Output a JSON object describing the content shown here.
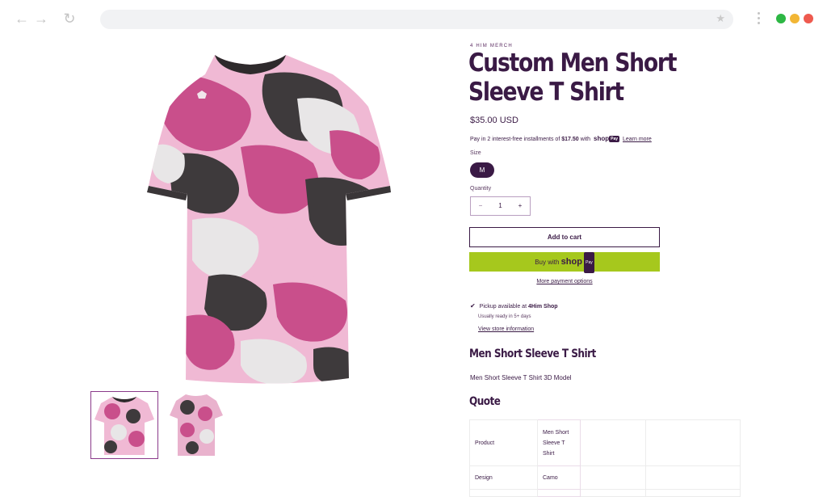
{
  "browser": {
    "back_icon": "arrow-left-icon",
    "forward_icon": "arrow-right-icon",
    "reload_icon": "reload-icon",
    "bookmark_icon": "star-icon",
    "menu_icon": "kebab-menu-icon",
    "window_dots": [
      "#2db744",
      "#f2b635",
      "#ee5a4f"
    ]
  },
  "product": {
    "vendor": "4 HIM MERCH",
    "title": "Custom Men Short Sleeve T Shirt",
    "price": "$35.00 USD",
    "installments": {
      "prefix": "Pay in 2 interest-free installments of",
      "amount": "$17.50",
      "with": "with",
      "brand": "shop",
      "pay_badge": "Pay",
      "learn_more": "Learn more"
    },
    "size_label": "Size",
    "size_selected": "M",
    "quantity_label": "Quantity",
    "quantity": "1",
    "minus": "−",
    "plus": "+",
    "add_to_cart": "Add to cart",
    "buy_with": "Buy with",
    "buy_brand": "shop",
    "buy_badge": "Pay",
    "more_payment": "More payment options",
    "pickup_prefix": "Pickup available at",
    "pickup_store": "4Him Shop",
    "ready": "Usually ready in 5+ days",
    "view_store": "View store information",
    "desc_heading": "Men Short Sleeve T Shirt",
    "desc_text": "Men Short Sleeve T Shirt 3D Model",
    "quote_heading": "Quote",
    "quote_rows": [
      {
        "label": "Product",
        "value": "Men Short Sleeve T Shirt"
      },
      {
        "label": "Design",
        "value": "Camo"
      }
    ],
    "colors": {
      "accent": "#3a1a45",
      "shop_pay_green": "#a6c81d",
      "camo_pink": "#c94f8b",
      "camo_light": "#f0b9d4",
      "camo_dark": "#3e3a3c"
    }
  }
}
